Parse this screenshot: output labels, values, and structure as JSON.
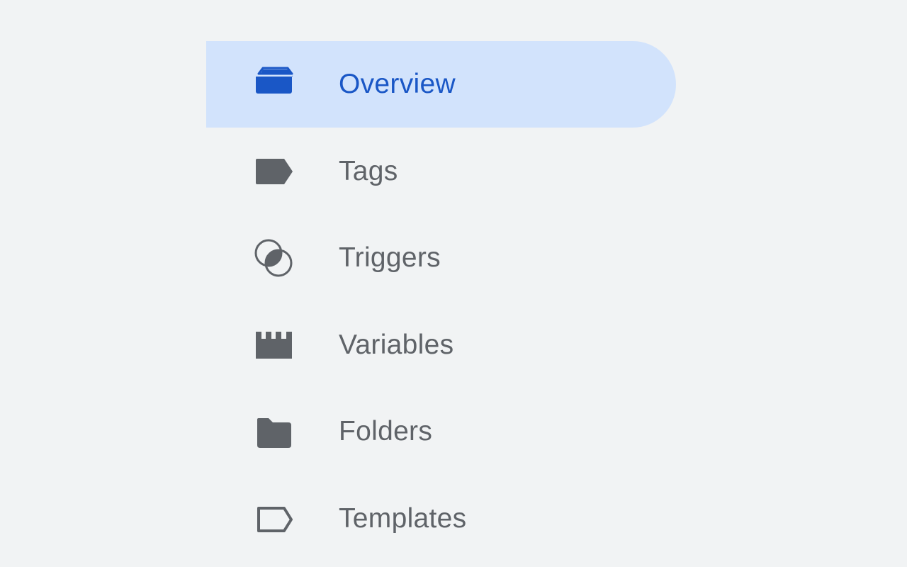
{
  "accent_color": "#1a57c6",
  "active_background": "#d2e3fc",
  "icon_color": "#5f6368",
  "nav": {
    "items": [
      {
        "label": "Overview",
        "icon": "overview-icon",
        "active": true
      },
      {
        "label": "Tags",
        "icon": "tag-icon",
        "active": false
      },
      {
        "label": "Triggers",
        "icon": "triggers-icon",
        "active": false
      },
      {
        "label": "Variables",
        "icon": "variables-icon",
        "active": false
      },
      {
        "label": "Folders",
        "icon": "folder-icon",
        "active": false
      },
      {
        "label": "Templates",
        "icon": "template-icon",
        "active": false
      }
    ]
  }
}
